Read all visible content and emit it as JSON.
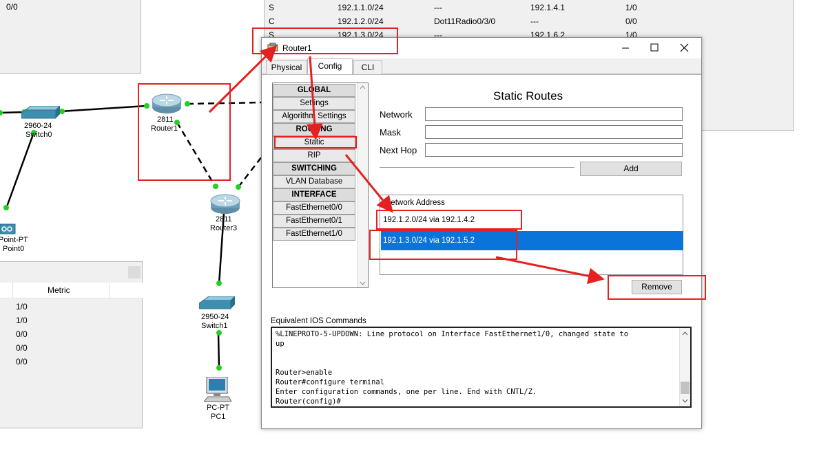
{
  "topleft_panel": {
    "value": "0/0"
  },
  "routing_table": {
    "rows": [
      {
        "type": "S",
        "network": "192.1.1.0/24",
        "port": "---",
        "next_hop": "192.1.4.1",
        "metric": "1/0"
      },
      {
        "type": "C",
        "network": "192.1.2.0/24",
        "port": "Dot11Radio0/3/0",
        "next_hop": "---",
        "metric": "0/0"
      },
      {
        "type": "S",
        "network": "192.1.3.0/24",
        "port": "---",
        "next_hop": "192.1.6.2",
        "metric": "1/0"
      }
    ]
  },
  "bottomleft_panel": {
    "header": "Metric",
    "values": [
      "1/0",
      "1/0",
      "0/0",
      "0/0",
      "0/0"
    ]
  },
  "topology": {
    "switch0": {
      "model": "2960-24",
      "name": "Switch0"
    },
    "router1": {
      "model": "2811",
      "name": "Router1"
    },
    "router3": {
      "model": "2811",
      "name": "Router3"
    },
    "switch1": {
      "model": "2950-24",
      "name": "Switch1"
    },
    "pc1": {
      "model": "PC-PT",
      "name": "PC1"
    },
    "ap": {
      "model": "Point-PT",
      "name": "Point0"
    }
  },
  "window": {
    "title": "Router1",
    "tabs": [
      "Physical",
      "Config",
      "CLI"
    ],
    "active_tab": "Config",
    "sidebar": [
      {
        "label": "GLOBAL",
        "header": true
      },
      {
        "label": "Settings",
        "header": false
      },
      {
        "label": "Algorithm Settings",
        "header": false
      },
      {
        "label": "ROUTING",
        "header": true
      },
      {
        "label": "Static",
        "header": false
      },
      {
        "label": "RIP",
        "header": false
      },
      {
        "label": "SWITCHING",
        "header": true
      },
      {
        "label": "VLAN Database",
        "header": false
      },
      {
        "label": "INTERFACE",
        "header": true
      },
      {
        "label": "FastEthernet0/0",
        "header": false
      },
      {
        "label": "FastEthernet0/1",
        "header": false
      },
      {
        "label": "FastEthernet1/0",
        "header": false
      }
    ],
    "static_routes": {
      "title": "Static Routes",
      "network_label": "Network",
      "mask_label": "Mask",
      "next_hop_label": "Next Hop",
      "network_value": "",
      "mask_value": "",
      "next_hop_value": "",
      "add_button": "Add",
      "list_header": "Network Address",
      "routes": [
        "192.1.2.0/24 via 192.1.4.2",
        "192.1.3.0/24 via 192.1.5.2"
      ],
      "selected_index": 1,
      "remove_button": "Remove"
    },
    "ios": {
      "label": "Equivalent IOS Commands",
      "lines": [
        "%LINEPROTO-5-UPDOWN: Line protocol on Interface FastEthernet1/0, changed state to",
        "up",
        "",
        "",
        "Router>enable",
        "Router#configure terminal",
        "Enter configuration commands, one per line.  End with CNTL/Z.",
        "Router(config)#"
      ]
    }
  },
  "colors": {
    "annotation_red": "#e52020",
    "selection_blue": "#0a74da",
    "link_green": "#22d022"
  }
}
